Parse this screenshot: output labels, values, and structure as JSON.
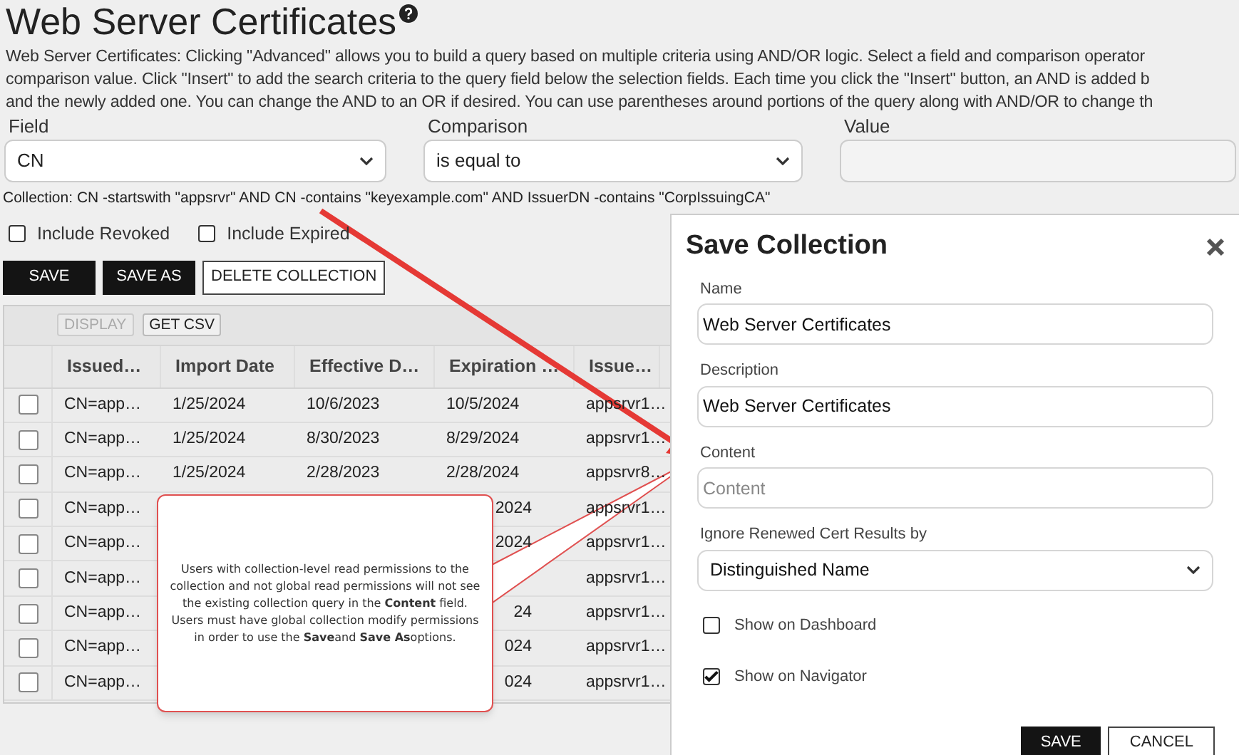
{
  "page": {
    "title": "Web Server Certificates"
  },
  "description_lines": [
    "Web Server Certificates: Clicking \"Advanced\" allows you to build a query based on multiple criteria using AND/OR logic. Select a field and comparison operator",
    "comparison value. Click \"Insert\" to add the search criteria to the query field below the selection fields. Each time you click the \"Insert\" button, an AND is added b",
    "and the newly added one. You can change the AND to an OR if desired. You can use parentheses around portions of the query along with AND/OR to change th"
  ],
  "filters": [
    {
      "label": "Field",
      "kind": "select",
      "value": "CN"
    },
    {
      "label": "Comparison",
      "kind": "select",
      "value": "is equal to"
    },
    {
      "label": "Value",
      "kind": "input"
    }
  ],
  "collection_query": "Collection: CN -startswith \"appsrvr\" AND CN -contains \"keyexample.com\" AND IssuerDN -contains \"CorpIssuingCA\"",
  "options": [
    {
      "label": "Include Revoked",
      "checked": false
    },
    {
      "label": "Include Expired",
      "checked": false
    }
  ],
  "actions": [
    {
      "label": "SAVE",
      "kind": "primary"
    },
    {
      "label": "SAVE AS",
      "kind": "primary"
    },
    {
      "label": "DELETE COLLECTION",
      "kind": "outline"
    }
  ],
  "table": {
    "tools": [
      {
        "label": "DISPLAY",
        "disabled": true
      },
      {
        "label": "GET CSV",
        "disabled": false
      }
    ],
    "columns": [
      "Issued…",
      "Import Date",
      "Effective D…",
      "Expiration …",
      "Issue…"
    ],
    "rows": [
      {
        "kind": "full",
        "checked": false,
        "cells": [
          "CN=app…",
          "1/25/2024",
          "10/6/2023",
          "10/5/2024",
          "appsrvr1…"
        ]
      },
      {
        "kind": "full",
        "checked": false,
        "cells": [
          "CN=app…",
          "1/25/2024",
          "8/30/2023",
          "8/29/2024",
          "appsrvr1…"
        ]
      },
      {
        "kind": "full",
        "checked": false,
        "cells": [
          "CN=app…",
          "1/25/2024",
          "2/28/2023",
          "2/28/2024",
          "appsrvr8…"
        ]
      },
      {
        "kind": "covered",
        "checked": false,
        "issued": "CN=app…",
        "expiration": "2024",
        "issuer": "appsrvr1…"
      },
      {
        "kind": "covered",
        "checked": false,
        "issued": "CN=app…",
        "expiration": "2024",
        "issuer": "appsrvr1…"
      },
      {
        "kind": "covered",
        "checked": false,
        "issued": "CN=app…",
        "issuer": "appsrvr1…"
      },
      {
        "kind": "covered",
        "checked": false,
        "issued": "CN=app…",
        "expiration": "24",
        "issuer": "appsrvr1…"
      },
      {
        "kind": "covered",
        "checked": false,
        "issued": "CN=app…",
        "expiration": "024",
        "issuer": "appsrvr1…"
      },
      {
        "kind": "covered",
        "checked": false,
        "issued": "CN=app…",
        "expiration": "024",
        "issuer": "appsrvr1…"
      }
    ]
  },
  "callout": {
    "text": "Users with collection-level read permissions to the collection and not global read permissions will not see the existing collection query in the **Content** field. Users must have global collection modify permissions in order to use the **Save**and **Save As**options."
  },
  "dialog": {
    "title": "Save Collection",
    "fields": [
      {
        "label": "Name",
        "kind": "input",
        "value": "Web Server Certificates"
      },
      {
        "label": "Description",
        "kind": "input",
        "value": "Web Server Certificates"
      },
      {
        "label": "Content",
        "kind": "input",
        "placeholder": "Content"
      },
      {
        "label": "Ignore Renewed Cert Results by",
        "kind": "select",
        "value": "Distinguished Name"
      }
    ],
    "checkboxes": [
      {
        "label": "Show on Dashboard",
        "checked": false
      },
      {
        "label": "Show on Navigator",
        "checked": true
      }
    ],
    "buttons": [
      {
        "label": "SAVE",
        "kind": "primary"
      },
      {
        "label": "CANCEL",
        "kind": "outline"
      }
    ]
  }
}
